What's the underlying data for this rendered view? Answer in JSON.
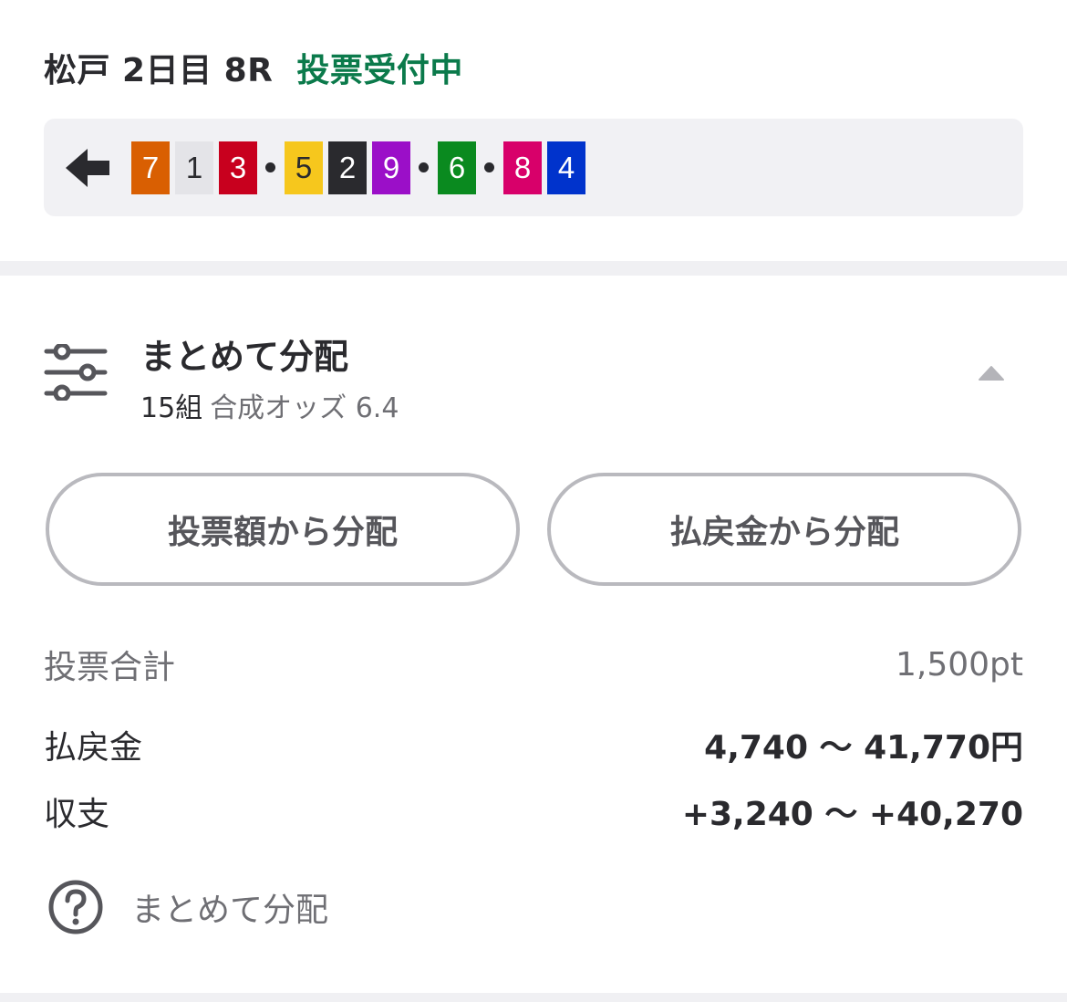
{
  "header": {
    "race_name": "松戸 2日目 8R",
    "status": "投票受付中",
    "status_color": "#0b7a4b"
  },
  "combination": {
    "back_icon": "arrow-left-icon",
    "groups": [
      [
        {
          "number": "7",
          "bg": "#d95f02",
          "fg": "#ffffff"
        },
        {
          "number": "1",
          "bg": "#e4e4e8",
          "fg": "#2a2a2e"
        },
        {
          "number": "3",
          "bg": "#c8001e",
          "fg": "#ffffff"
        }
      ],
      [
        {
          "number": "5",
          "bg": "#f6c71d",
          "fg": "#2a2a2e"
        },
        {
          "number": "2",
          "bg": "#2a2a2e",
          "fg": "#ffffff"
        },
        {
          "number": "9",
          "bg": "#9b0fc8",
          "fg": "#ffffff"
        }
      ],
      [
        {
          "number": "6",
          "bg": "#0a8a1f",
          "fg": "#ffffff"
        }
      ],
      [
        {
          "number": "8",
          "bg": "#d8006a",
          "fg": "#ffffff"
        },
        {
          "number": "4",
          "bg": "#0033cc",
          "fg": "#ffffff"
        }
      ]
    ]
  },
  "distribution": {
    "icon": "sliders-icon",
    "title": "まとめて分配",
    "count": "15組",
    "odds_label": "合成オッズ 6.4",
    "toggle_icon": "caret-up-icon",
    "buttons": {
      "by_bet": "投票額から分配",
      "by_payout": "払戻金から分配"
    },
    "summary": {
      "bet_total_label": "投票合計",
      "bet_total_value": "1,500pt",
      "payout_label": "払戻金",
      "payout_value": "4,740 〜 41,770円",
      "balance_label": "収支",
      "balance_value": "+3,240 〜 +40,270"
    },
    "help": {
      "icon": "question-circle-icon",
      "label": "まとめて分配"
    }
  }
}
